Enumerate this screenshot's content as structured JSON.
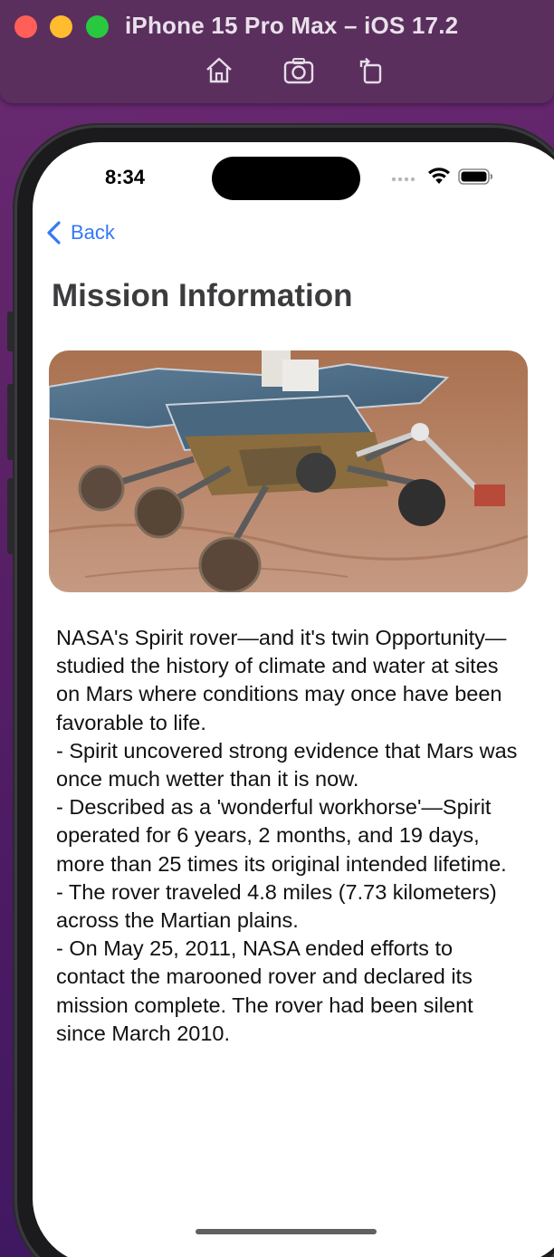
{
  "simulator": {
    "title": "iPhone 15 Pro Max – iOS 17.2",
    "toolbar": [
      "home-icon",
      "screenshot-icon",
      "rotate-icon"
    ]
  },
  "status_bar": {
    "time": "8:34",
    "icons": [
      "signal-icon",
      "wifi-icon",
      "battery-icon"
    ]
  },
  "nav": {
    "back_label": "Back"
  },
  "page": {
    "title": "Mission Information",
    "image_alt_subject": "Mars rover on reddish martian soil",
    "description": "NASA's Spirit rover—and it's twin Opportunity—studied the history of climate and water at sites on Mars where conditions may once have been favorable to life.\n- Spirit uncovered strong evidence that Mars was once much wetter than it is now.\n- Described as a 'wonderful workhorse'—Spirit operated for 6 years, 2 months, and 19 days, more than 25 times its original intended lifetime.\n- The rover traveled 4.8 miles (7.73 kilometers) across the Martian plains.\n- On May 25, 2011, NASA ended efforts to contact the marooned rover and declared its mission complete. The rover had been silent since March 2010."
  },
  "colors": {
    "accent": "#3478f6",
    "title_text": "#3c3c3e",
    "background": "#ffffff"
  }
}
